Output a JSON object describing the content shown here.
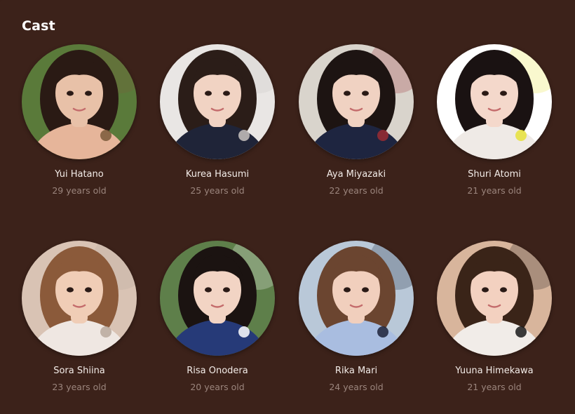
{
  "section": {
    "title": "Cast"
  },
  "cast": [
    {
      "name": "Yui Hatano",
      "age": "29 years old",
      "bg": "#5a7a3a",
      "hair": "#2a1a14",
      "skin": "#e8c1a8",
      "outfit": "#e6b59a",
      "accent": "#7a5a3a"
    },
    {
      "name": "Kurea Hasumi",
      "age": "25 years old",
      "bg": "#e9e6e4",
      "hair": "#2b1d18",
      "skin": "#f1d3c3",
      "outfit": "#1f2438",
      "accent": "#c9c3c0"
    },
    {
      "name": "Aya Miyazaki",
      "age": "22 years old",
      "bg": "#d9d4cc",
      "hair": "#1d1412",
      "skin": "#f0d2c2",
      "outfit": "#1e2540",
      "accent": "#9a2b33"
    },
    {
      "name": "Shuri Atomi",
      "age": "21 years old",
      "bg": "#ffffff",
      "hair": "#1a1212",
      "skin": "#f4d8cb",
      "outfit": "#efeae6",
      "accent": "#e6e23a"
    },
    {
      "name": "Sora Shiina",
      "age": "23 years old",
      "bg": "#d9c3b4",
      "hair": "#8b5a3a",
      "skin": "#f0cdb6",
      "outfit": "#efe7e2",
      "accent": "#b9a89c"
    },
    {
      "name": "Risa Onodera",
      "age": "20 years old",
      "bg": "#5e7f4a",
      "hair": "#1b1311",
      "skin": "#f2d4c4",
      "outfit": "#263a78",
      "accent": "#ffffff"
    },
    {
      "name": "Rika Mari",
      "age": "24 years old",
      "bg": "#b9c8d8",
      "hair": "#6b4530",
      "skin": "#f1cfbd",
      "outfit": "#a9bde0",
      "accent": "#1d2238"
    },
    {
      "name": "Yuuna Himekawa",
      "age": "21 years old",
      "bg": "#d8b59c",
      "hair": "#3a2418",
      "skin": "#f3d1c0",
      "outfit": "#f1ece8",
      "accent": "#1a1a1a"
    }
  ]
}
